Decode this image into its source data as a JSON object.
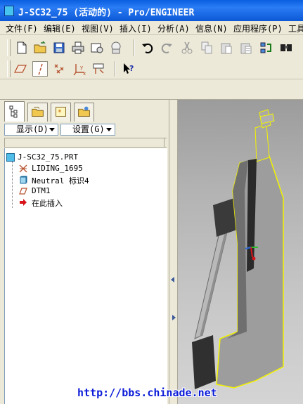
{
  "window": {
    "title": "J-SC32_75 (活动的) - Pro/ENGINEER"
  },
  "menu": {
    "items": [
      "文件(F)",
      "编辑(E)",
      "视图(V)",
      "插入(I)",
      "分析(A)",
      "信息(N)",
      "应用程序(P)",
      "工具"
    ]
  },
  "toolbar": {
    "icons": [
      "new-file-icon",
      "open-folder-icon",
      "save-icon",
      "print-icon",
      "send-mail-icon",
      "mail-icon",
      "undo-icon",
      "redo-icon",
      "cut-icon",
      "copy-icon",
      "paste-icon",
      "paste-special-icon",
      "regenerate-icon",
      "find-icon"
    ],
    "icons2": [
      "plane-display-icon",
      "axis-display-icon",
      "point-display-icon",
      "csys-display-icon",
      "annotation-display-icon",
      "context-help-icon"
    ]
  },
  "navigator": {
    "tabs": [
      "model-tree-tab",
      "folder-browser-tab",
      "favorites-tab",
      "connections-tab"
    ],
    "show_label": "显示(D)",
    "settings_label": "设置(G)",
    "tree": {
      "root": "J-SC32_75.PRT",
      "items": [
        "LIDING_1695",
        "Neutral 标识4",
        "DTM1",
        "在此插入"
      ]
    }
  },
  "colors": {
    "title_blue": "#0a5fe0",
    "model_gray": "#9d9d9d",
    "model_dark": "#2b2b2b",
    "highlight_yellow": "#f2f200",
    "insert_arrow": "#d8141b"
  },
  "watermark": "http://bbs.chinade.net"
}
